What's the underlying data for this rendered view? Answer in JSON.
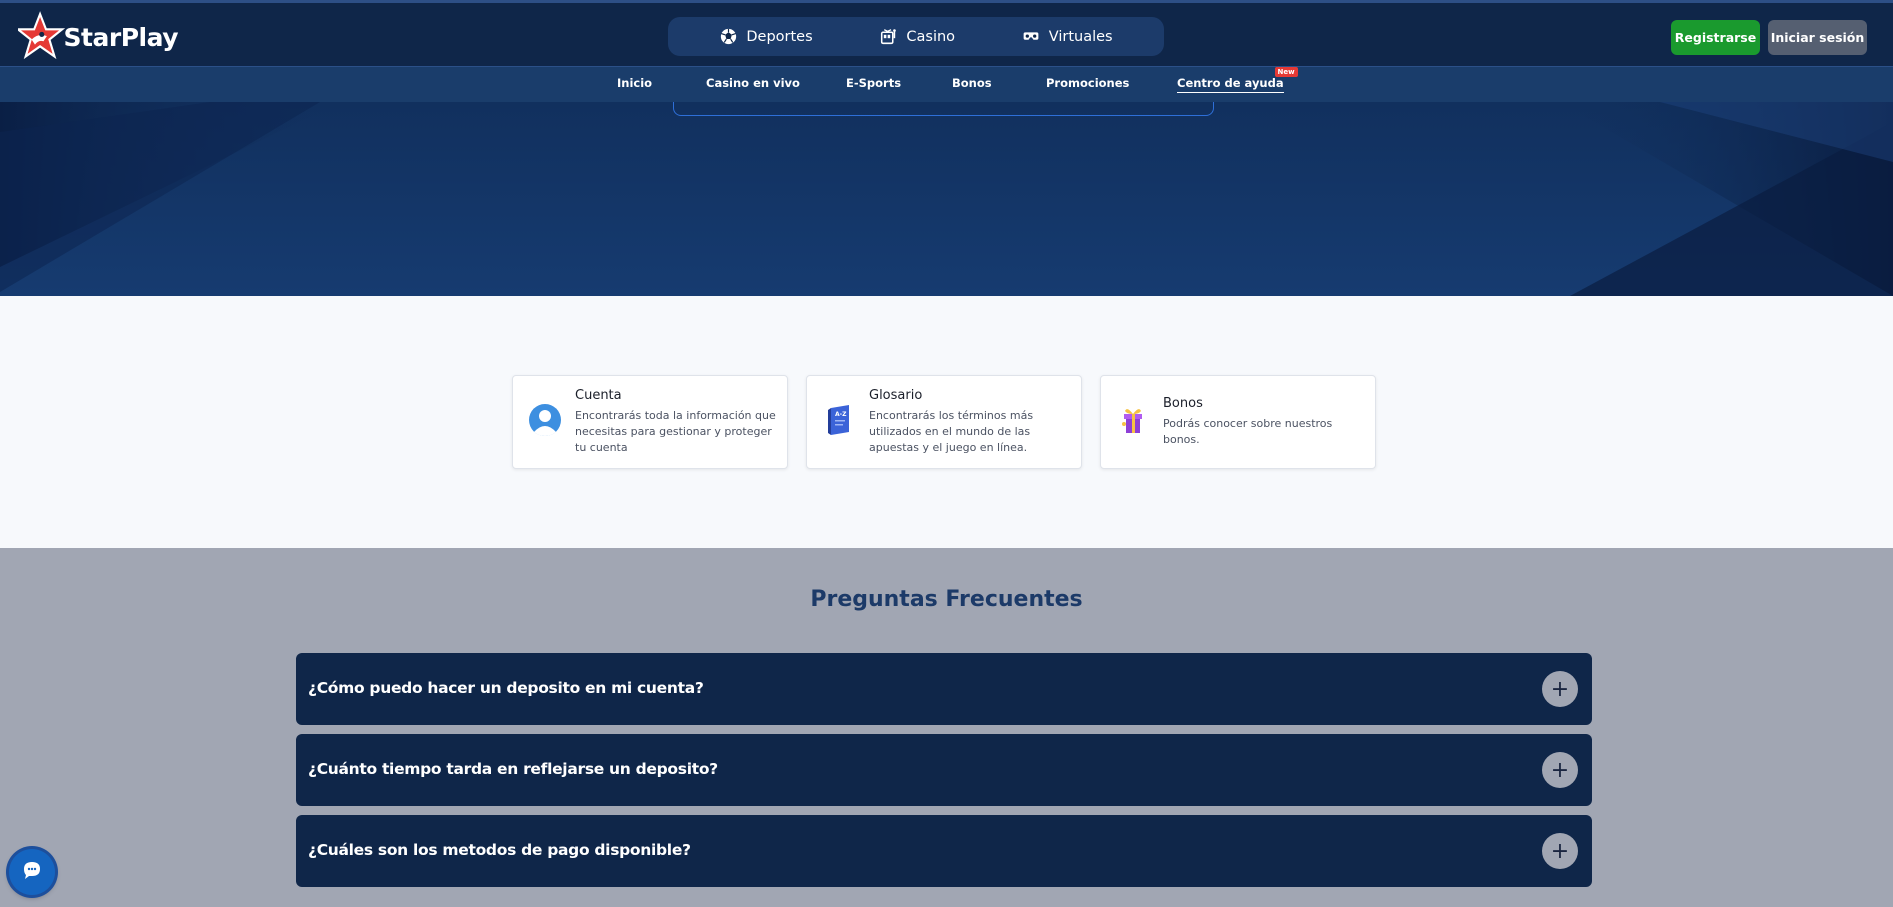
{
  "brand": {
    "name": "StarPlay"
  },
  "main_nav": [
    {
      "label": "Deportes",
      "icon": "soccer-ball-icon"
    },
    {
      "label": "Casino",
      "icon": "slot-machine-icon"
    },
    {
      "label": "Virtuales",
      "icon": "vr-goggles-icon"
    }
  ],
  "auth": {
    "register_label": "Registrarse",
    "login_label": "Iniciar sesión"
  },
  "sub_nav": [
    {
      "label": "Inicio"
    },
    {
      "label": "Casino en vivo"
    },
    {
      "label": "E-Sports"
    },
    {
      "label": "Bonos"
    },
    {
      "label": "Promociones"
    },
    {
      "label": "Centro de ayuda",
      "active": true,
      "badge": "New"
    }
  ],
  "help_cards": [
    {
      "title": "Cuenta",
      "description": "Encontrarás toda la información que necesitas para gestionar y proteger tu cuenta",
      "icon": "user-avatar-icon"
    },
    {
      "title": "Glosario",
      "description": "Encontrarás los términos más utilizados en el mundo de las apuestas y el juego en línea.",
      "icon": "glossary-book-icon"
    },
    {
      "title": "Bonos",
      "description": "Podrás conocer sobre nuestros bonos.",
      "icon": "gift-box-icon"
    }
  ],
  "faq": {
    "title": "Preguntas Frecuentes",
    "items": [
      {
        "question": "¿Cómo puedo hacer un deposito en mi cuenta?"
      },
      {
        "question": "¿Cuánto tiempo tarda en reflejarse un deposito?"
      },
      {
        "question": "¿Cuáles son los metodos de pago disponible?"
      }
    ]
  },
  "colors": {
    "header_bg": "#0f2649",
    "subnav_bg": "#1a3d6b",
    "register_green": "#1a9a2e",
    "login_gray": "#555f71",
    "faq_bg": "#a1a6b3",
    "faq_title": "#1c3a68"
  }
}
